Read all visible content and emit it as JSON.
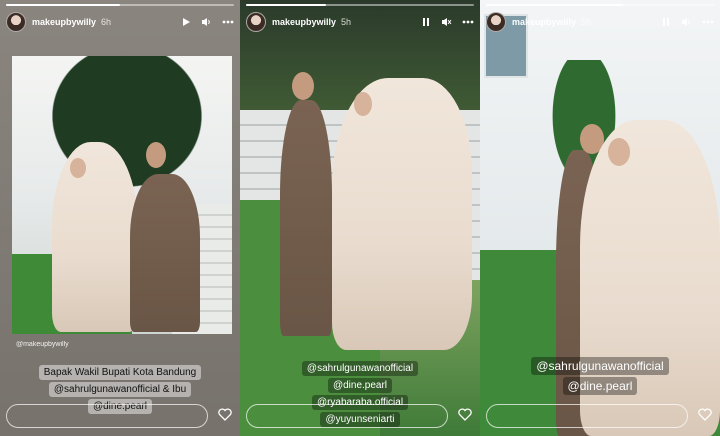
{
  "stories": [
    {
      "username": "makeupbywilly",
      "time": "6h",
      "progress": 0.5,
      "mention": "@makeupbywilly",
      "caption_lines": [
        "Bapak Wakil Bupati Kota Bandung",
        "@sahrulgunawanofficial & Ibu",
        "@dine.pearl"
      ],
      "controls": [
        "play-icon",
        "volume-icon",
        "more-icon"
      ]
    },
    {
      "username": "makeupbywilly",
      "time": "5h",
      "progress": 0.35,
      "caption_lines": [
        "@sahrulgunawanofficial",
        "@dine.pearl",
        "@ryabaraba.official",
        "@yuyunseniarti"
      ],
      "controls": [
        "pause-icon",
        "mute-icon",
        "more-icon"
      ]
    },
    {
      "username": "makeupbywilly",
      "time": "5h",
      "progress": 0.6,
      "caption_lines": [
        "@sahrulgunawanofficial",
        "@dine.pearl"
      ],
      "controls": [
        "pause-icon",
        "volume-icon",
        "more-icon"
      ]
    }
  ],
  "colors": {
    "text": "#ffffff",
    "pill_light": "rgba(255,255,255,0.45)",
    "pill_dark": "rgba(0,0,0,0.35)"
  }
}
